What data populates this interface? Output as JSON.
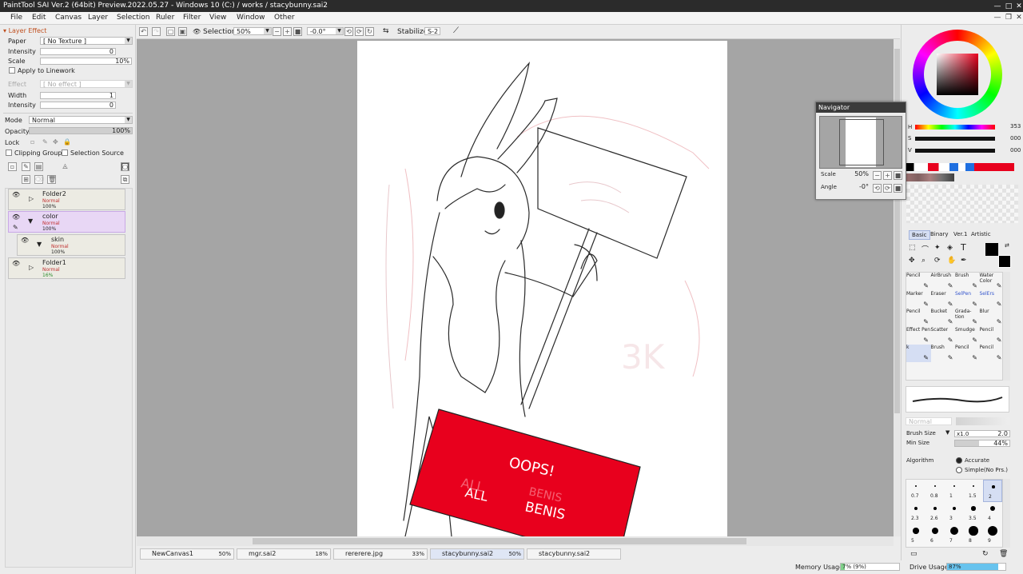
{
  "window": {
    "title": "PaintTool SAI Ver.2 (64bit) Preview.2022.05.27 - Windows 10 (C:) / works / stacybunny.sai2"
  },
  "menu": [
    "File",
    "Edit",
    "Canvas",
    "Layer",
    "Selection",
    "Ruler",
    "Filter",
    "View",
    "Window",
    "Other"
  ],
  "layer_effect": {
    "header": "Layer Effect",
    "paper_label": "Paper",
    "paper_value": "[ No Texture ]",
    "intensity_label": "Intensity",
    "intensity_value": "0",
    "scale_label": "Scale",
    "scale_value": "10%",
    "apply_linework": "Apply to Linework",
    "effect_label": "Effect",
    "effect_value": "[ No effect ]",
    "width_label": "Width",
    "width_value": "1",
    "intensity2_label": "Intensity",
    "intensity2_value": "0"
  },
  "layer_props": {
    "mode_label": "Mode",
    "mode_value": "Normal",
    "opacity_label": "Opacity",
    "opacity_value": "100%",
    "opacity_fraction": 1.0,
    "lock_label": "Lock",
    "clipping_group": "Clipping Group",
    "selection_source": "Selection Source"
  },
  "layers": [
    {
      "name": "Folder2",
      "mode": "Normal",
      "opacity": "100%"
    },
    {
      "name": "color",
      "mode": "Normal",
      "opacity": "100%"
    },
    {
      "name": "skin",
      "mode": "Normal",
      "opacity": "100%"
    },
    {
      "name": "Folder1",
      "mode": "Normal",
      "opacity": "16%"
    }
  ],
  "toolbar": {
    "selection_label": "Selection",
    "zoom_value": "50%",
    "angle_value": "-0.0°",
    "stabilizer_label": "Stabilizer",
    "stabilizer_value": "S-2"
  },
  "canvas_text": {
    "oops": "OOPS!",
    "all": "ALL",
    "benis": "BENIS",
    "faint_all": "ALL",
    "faint_benis": "BENIS",
    "sign_faint": "3K"
  },
  "navigator": {
    "title": "Navigator",
    "scale_label": "Scale",
    "scale_value": "50%",
    "angle_label": "Angle",
    "angle_value": "-0°"
  },
  "color": {
    "h_label": "H",
    "s_label": "S",
    "v_label": "V",
    "h_value": "353",
    "s_value": "000",
    "v_value": "000",
    "current": "#000000",
    "accent_red": "#e8001d"
  },
  "tool_tabs": [
    "Basic",
    "Binary",
    "Ver.1",
    "Artistic"
  ],
  "tools": [
    {
      "name": "Pencil"
    },
    {
      "name": "AirBrush"
    },
    {
      "name": "Brush"
    },
    {
      "name": "Water Color"
    },
    {
      "name": "Marker"
    },
    {
      "name": "Eraser"
    },
    {
      "name": "SelPen"
    },
    {
      "name": "SelErs"
    },
    {
      "name": "Pencil"
    },
    {
      "name": "Bucket"
    },
    {
      "name": "Grada- tion"
    },
    {
      "name": "Blur"
    },
    {
      "name": "Effect Pen"
    },
    {
      "name": "Scatter"
    },
    {
      "name": "Smudge"
    },
    {
      "name": "Pencil"
    },
    {
      "name": "k"
    },
    {
      "name": "Brush"
    },
    {
      "name": "Pencil"
    },
    {
      "name": "Pencil"
    }
  ],
  "brush": {
    "blend_mode": "Normal",
    "size_label": "Brush Size",
    "size_mult": "x1.0",
    "size_value": "2.0",
    "min_label": "Min Size",
    "min_value": "44%",
    "min_fraction": 0.44,
    "algorithm_label": "Algorithm",
    "accurate": "Accurate",
    "simple": "Simple(No Prs.)"
  },
  "brush_sizes": [
    "0.7",
    "0.8",
    "1",
    "1.5",
    "2",
    "2.3",
    "2.6",
    "3",
    "3.5",
    "4",
    "5",
    "6",
    "7",
    "8",
    "9"
  ],
  "tabs": [
    {
      "name": "NewCanvas1",
      "pct": "50%"
    },
    {
      "name": "mgr.sai2",
      "pct": "18%"
    },
    {
      "name": "rererere.jpg",
      "pct": "33%"
    },
    {
      "name": "stacybunny.sai2",
      "pct": "50%"
    },
    {
      "name": "stacybunny.sai2",
      "pct": ""
    }
  ],
  "status": {
    "memory_label": "Memory Usage",
    "memory_value": "7% (9%)",
    "memory_fraction": 0.07,
    "drive_label": "Drive Usage",
    "drive_value": "87%",
    "drive_fraction": 0.87
  }
}
